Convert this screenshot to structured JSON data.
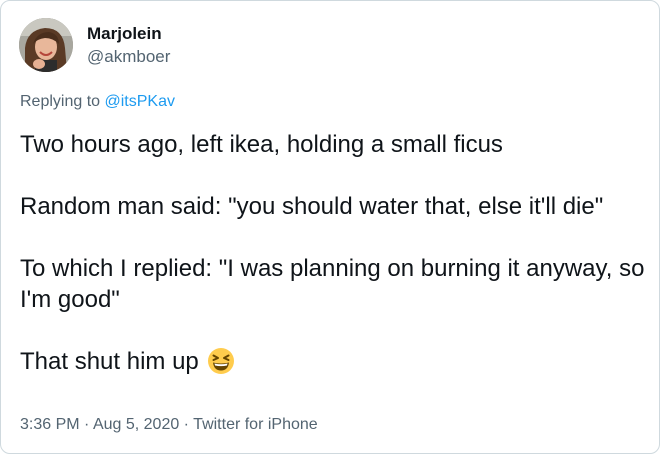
{
  "author": {
    "display_name": "Marjolein",
    "handle": "@akmboer"
  },
  "reply": {
    "prefix": "Replying to",
    "mention": "@itsPKav"
  },
  "tweet": {
    "paragraphs": [
      "Two hours ago, left ikea, holding a small ficus",
      "Random man said: \"you should water that, else it'll die\"",
      "To which I replied: \"I was planning on burning it anyway, so I'm good\"",
      "That shut him up"
    ],
    "emoji": "grinning-squinting-face"
  },
  "meta": {
    "time": "3:36 PM",
    "separator": " · ",
    "date": "Aug 5, 2020",
    "source": "Twitter for iPhone"
  },
  "colors": {
    "text": "#0f1419",
    "secondary": "#536471",
    "link": "#1d9bf0",
    "border": "#cfd9de"
  }
}
